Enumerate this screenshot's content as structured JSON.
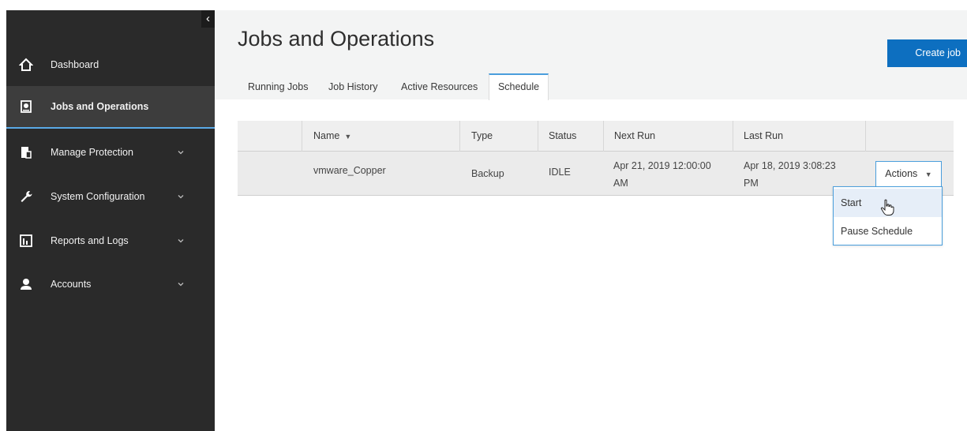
{
  "sidebar": {
    "collapse_glyph": "‹",
    "items": [
      {
        "label": "Dashboard",
        "icon": "home-icon",
        "active": false,
        "expandable": false
      },
      {
        "label": "Jobs and Operations",
        "icon": "jobs-icon",
        "active": true,
        "expandable": false
      },
      {
        "label": "Manage Protection",
        "icon": "protection-icon",
        "active": false,
        "expandable": true
      },
      {
        "label": "System Configuration",
        "icon": "wrench-icon",
        "active": false,
        "expandable": true
      },
      {
        "label": "Reports and Logs",
        "icon": "reports-icon",
        "active": false,
        "expandable": true
      },
      {
        "label": "Accounts",
        "icon": "user-icon",
        "active": false,
        "expandable": true
      }
    ]
  },
  "header": {
    "title": "Jobs and Operations",
    "create_label": "Create job",
    "tabs": [
      {
        "label": "Running Jobs",
        "active": false
      },
      {
        "label": "Job History",
        "active": false
      },
      {
        "label": "Active Resources",
        "active": false
      },
      {
        "label": "Schedule",
        "active": true
      }
    ]
  },
  "table": {
    "columns": [
      "Name",
      "Type",
      "Status",
      "Next Run",
      "Last Run"
    ],
    "rows": [
      {
        "name": "vmware_Copper",
        "type": "Backup",
        "status": "IDLE",
        "next_run_line1": "Apr 21, 2019 12:00:00",
        "next_run_line2": "AM",
        "last_run_line1": "Apr 18, 2019 3:08:23",
        "last_run_line2": "PM",
        "actions_label": "Actions"
      }
    ]
  },
  "dropdown": {
    "items": [
      "Start",
      "Pause Schedule"
    ],
    "hovered": "Start"
  },
  "colors": {
    "sidebar_bg": "#2a2a2a",
    "accent": "#0d6fc0",
    "active_border": "#5aa9e6"
  }
}
